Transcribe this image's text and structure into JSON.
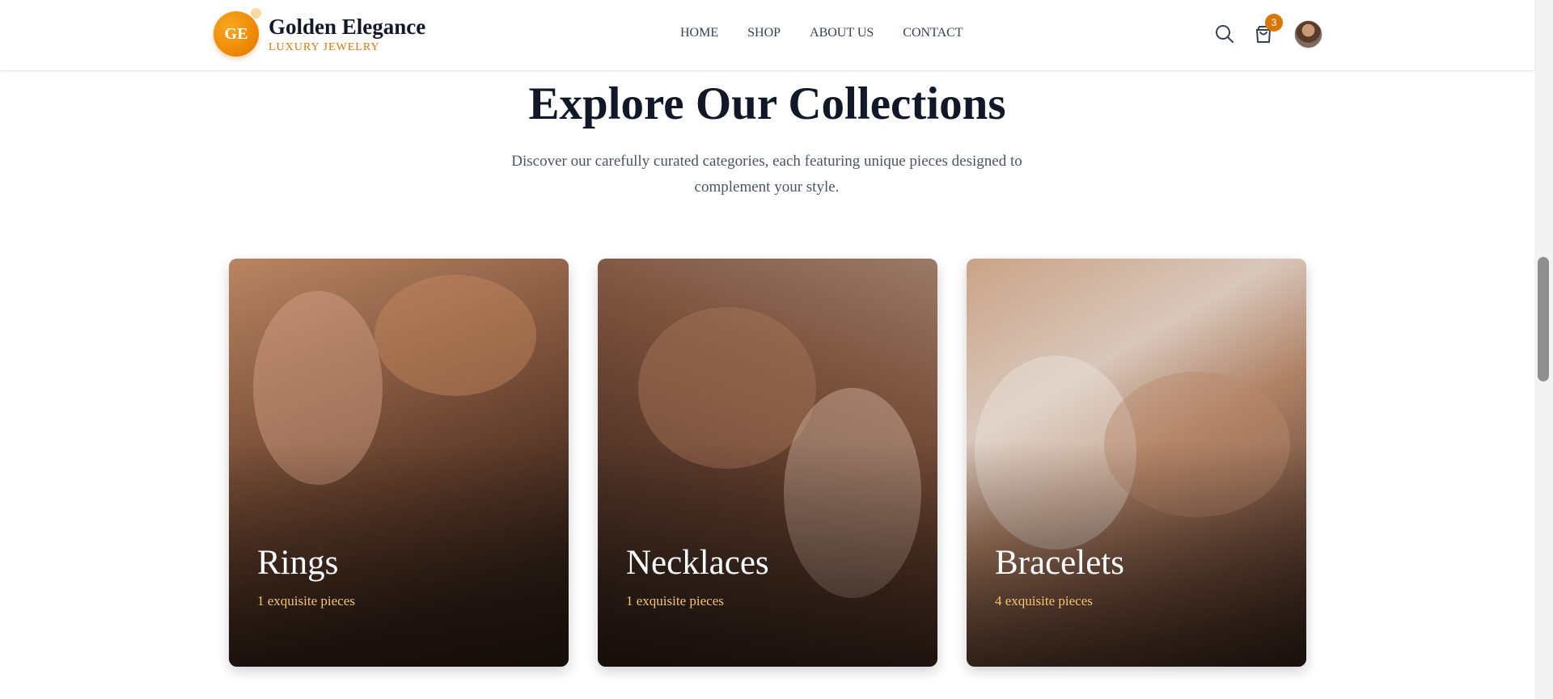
{
  "header": {
    "logo_initials": "GE",
    "brand_name": "Golden Elegance",
    "brand_tagline": "LUXURY JEWELRY",
    "nav": [
      {
        "label": "HOME"
      },
      {
        "label": "SHOP"
      },
      {
        "label": "ABOUT US"
      },
      {
        "label": "CONTACT"
      }
    ],
    "cart_count": "3",
    "icons": {
      "search": "search-icon",
      "cart": "shopping-bag-icon",
      "avatar": "user-avatar"
    }
  },
  "section": {
    "title": "Explore Our Collections",
    "subtitle": "Discover our carefully curated categories, each featuring unique pieces designed to complement your style."
  },
  "collections": [
    {
      "name": "Rings",
      "count": "1 exquisite pieces"
    },
    {
      "name": "Necklaces",
      "count": "1 exquisite pieces"
    },
    {
      "name": "Bracelets",
      "count": "4 exquisite pieces"
    }
  ],
  "colors": {
    "accent": "#d97706",
    "count_text": "#f6c46b",
    "title": "#111827"
  }
}
